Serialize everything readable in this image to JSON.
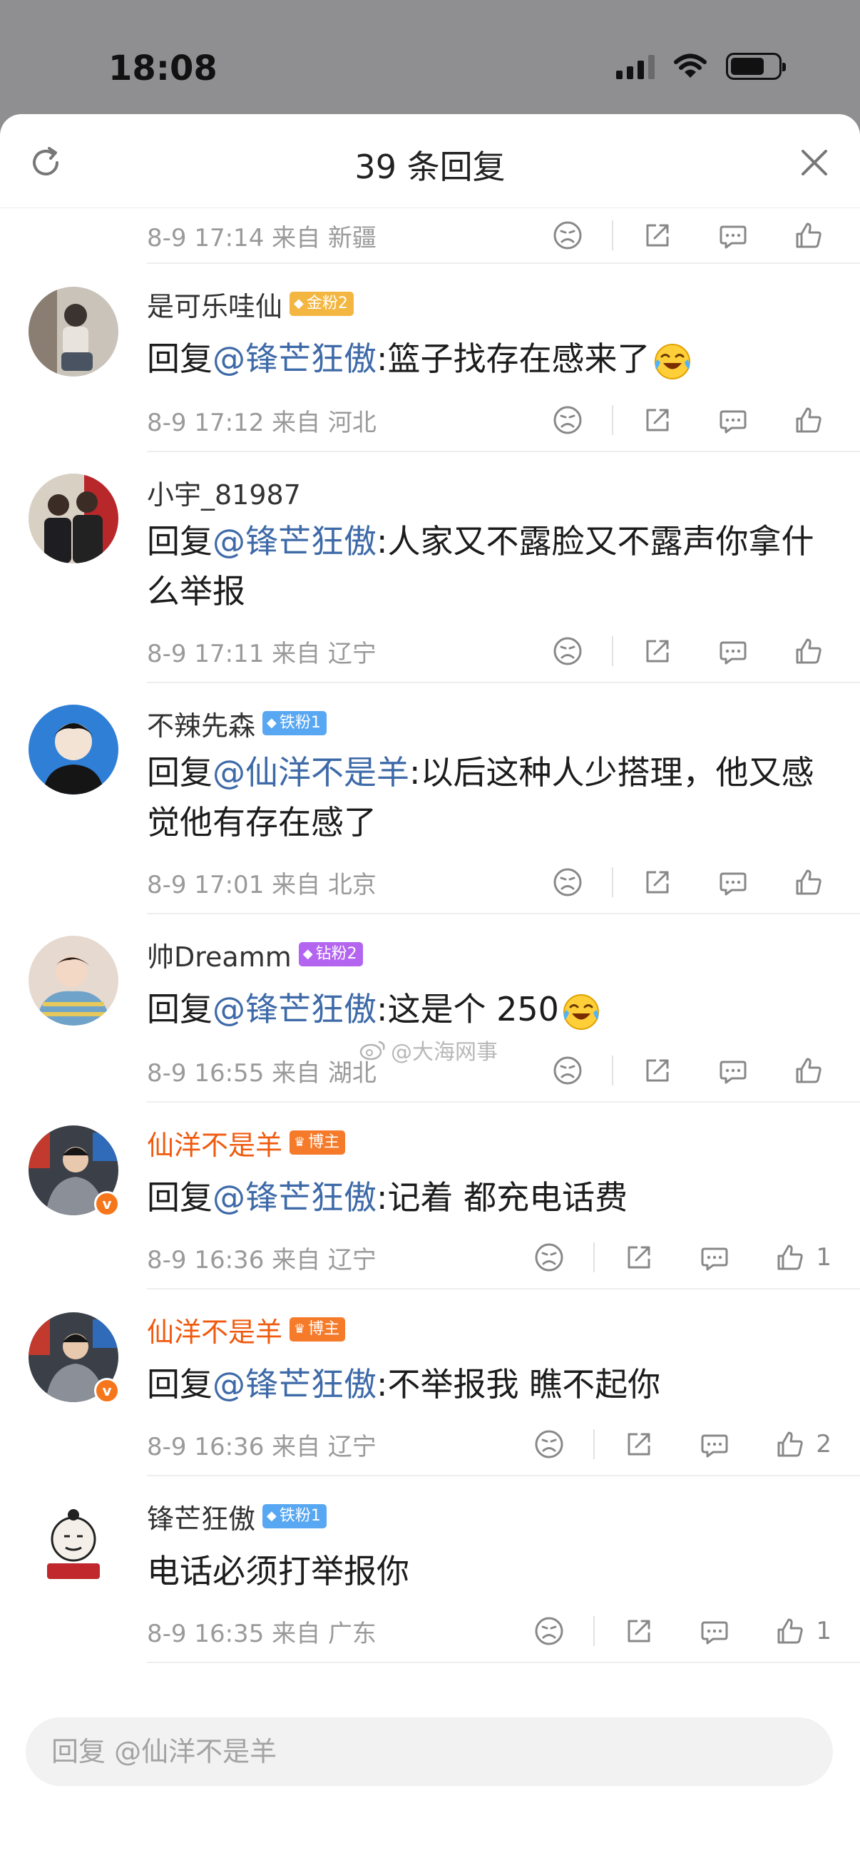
{
  "status": {
    "time": "18:08"
  },
  "header": {
    "title": "39 条回复"
  },
  "comments": [
    {
      "meta": "8-9 17:14 来自 新疆"
    },
    {
      "user": "是可乐哇仙",
      "badge": "金粉2",
      "prefix": "回复",
      "mention": "@锋芒狂傲",
      "body": ":篮子找存在感来了",
      "meta": "8-9 17:12 来自 河北"
    },
    {
      "user": "小宇_81987",
      "prefix": "回复",
      "mention": "@锋芒狂傲",
      "body": ":人家又不露脸又不露声你拿什么举报",
      "meta": "8-9 17:11 来自 辽宁"
    },
    {
      "user": "不辣先森",
      "badge": "铁粉1",
      "prefix": "回复",
      "mention": "@仙洋不是羊",
      "body": ":以后这种人少搭理，他又感觉他有存在感了",
      "meta": "8-9 17:01 来自 北京"
    },
    {
      "user": "帅Dreamm",
      "badge": "钻粉2",
      "prefix": "回复",
      "mention": "@锋芒狂傲",
      "body": ":这是个 250",
      "meta": "8-9 16:55 来自 湖北"
    },
    {
      "user": "仙洋不是羊",
      "badge": "博主",
      "prefix": "回复",
      "mention": "@锋芒狂傲",
      "body": ":记着 都充电话费",
      "meta": "8-9 16:36 来自 辽宁",
      "likes": "1"
    },
    {
      "user": "仙洋不是羊",
      "badge": "博主",
      "prefix": "回复",
      "mention": "@锋芒狂傲",
      "body": ":不举报我 瞧不起你",
      "meta": "8-9 16:36 来自 辽宁",
      "likes": "2"
    },
    {
      "user": "锋芒狂傲",
      "badge": "铁粉1",
      "body": "电话必须打举报你",
      "meta": "8-9 16:35 来自 广东",
      "likes": "1"
    }
  ],
  "reply": {
    "placeholder": "回复 @仙洋不是羊"
  },
  "watermark": "@大海网事",
  "icons": [
    "refresh-icon",
    "close-icon",
    "dislike-icon",
    "share-icon",
    "comment-icon",
    "like-icon",
    "weibo-icon"
  ],
  "colors": {
    "mention": "#3e6aa8",
    "blogger_name": "#f05a0f",
    "verified": "#f6761c"
  }
}
